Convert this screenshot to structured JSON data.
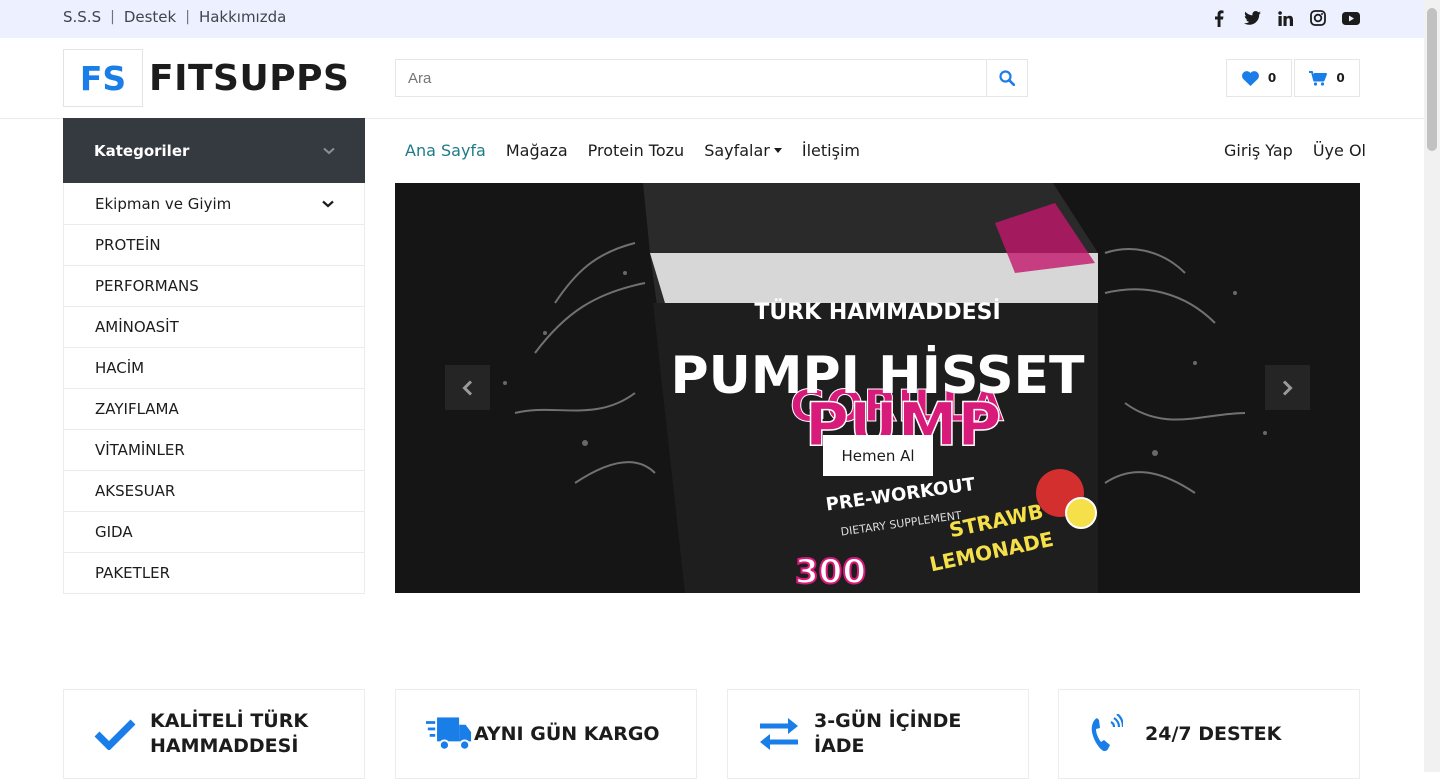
{
  "topbar": {
    "links": [
      "S.S.S",
      "Destek",
      "Hakkımızda"
    ],
    "social": [
      "facebook-icon",
      "twitter-icon",
      "linkedin-icon",
      "instagram-icon",
      "youtube-icon"
    ]
  },
  "brand": {
    "mark": "FS",
    "name": "FITSUPPS",
    "accent": "#1a7ee8"
  },
  "search": {
    "placeholder": "Ara",
    "value": ""
  },
  "wishlist": {
    "count": "0"
  },
  "cart": {
    "count": "0"
  },
  "categories": {
    "title": "Kategoriler",
    "items": [
      "Ekipman ve Giyim",
      "PROTEİN",
      "PERFORMANS",
      "AMİNOASİT",
      "HACİM",
      "ZAYIFLAMA",
      "VİTAMİNLER",
      "AKSESUAR",
      "GIDA",
      "PAKETLER"
    ]
  },
  "nav": {
    "items": [
      "Ana Sayfa",
      "Mağaza",
      "Protein Tozu",
      "Sayfalar",
      "İletişim"
    ],
    "right": [
      "Giriş Yap",
      "Üye Ol"
    ]
  },
  "hero": {
    "subtitle": "TÜRK HAMMADDESİ",
    "title": "PUMPI HİSSET",
    "cta": "Hemen Al"
  },
  "features": [
    {
      "icon": "check-icon",
      "line1": "KALİTELİ TÜRK",
      "line2": "HAMMADDESİ"
    },
    {
      "icon": "shipping-icon",
      "line1": "AYNI GÜN KARGO",
      "line2": ""
    },
    {
      "icon": "exchange-icon",
      "line1": "3-GÜN İÇİNDE",
      "line2": "İADE"
    },
    {
      "icon": "phone-icon",
      "line1": "24/7 DESTEK",
      "line2": ""
    }
  ]
}
